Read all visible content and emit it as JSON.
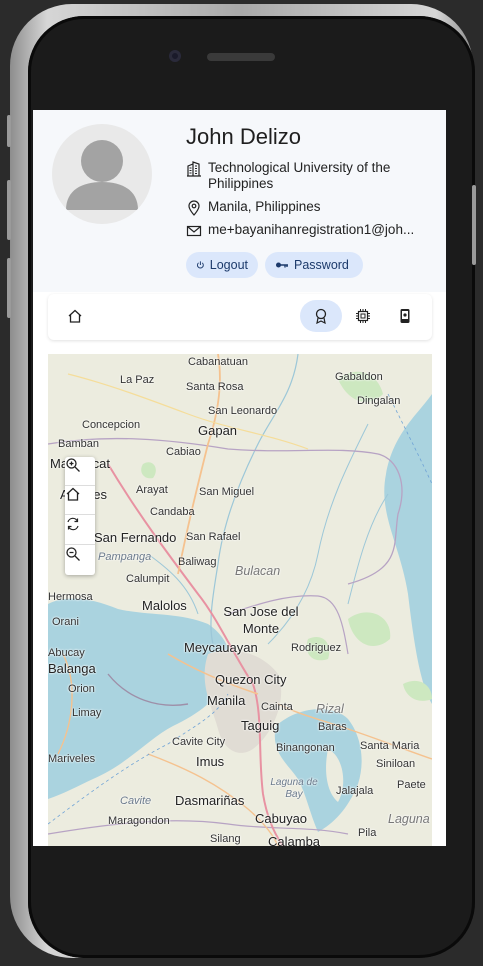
{
  "profile": {
    "name": "John Delizo",
    "university": "Technological University of the Philippines",
    "location": "Manila, Philippines",
    "email": "me+bayanihanregistration1@joh..."
  },
  "actions": {
    "logout_label": "Logout",
    "password_label": "Password"
  },
  "nav": {
    "items": [
      "home-icon",
      "badge-icon",
      "chip-icon",
      "device-icon"
    ],
    "active": "badge-icon"
  },
  "map": {
    "labels": {
      "cabanatuan": "Cabanatuan",
      "gabaldon": "Gabaldon",
      "lapaz": "La Paz",
      "santarosa": "Santa Rosa",
      "dingalan": "Dingalan",
      "sanleonardo": "San Leonardo",
      "concepcion": "Concepcion",
      "gapan": "Gapan",
      "bamban": "Bamban",
      "cabiao": "Cabiao",
      "mabalacat": "Mabalacat",
      "arayat": "Arayat",
      "sanmiguel": "San Miguel",
      "angeles": "Angeles",
      "candaba": "Candaba",
      "sanfernando": "San Fernando",
      "sanrafael": "San Rafael",
      "pampanga": "Pampanga",
      "baliwag": "Baliwag",
      "bulacan": "Bulacan",
      "calumpit": "Calumpit",
      "hermosa": "Hermosa",
      "malolos": "Malolos",
      "sanjosedelmonte": "San Jose del Monte",
      "orani": "Orani",
      "abucay": "Abucay",
      "meycauayan": "Meycauayan",
      "rodriguez": "Rodriguez",
      "balanga": "Balanga",
      "quezoncity": "Quezon City",
      "orion": "Orion",
      "manila": "Manila",
      "cainta": "Cainta",
      "rizal": "Rizal",
      "limay": "Limay",
      "taguig": "Taguig",
      "baras": "Baras",
      "mariveles": "Mariveles",
      "cavitecity": "Cavite City",
      "binangonan": "Binangonan",
      "santamaria": "Santa Maria",
      "imus": "Imus",
      "siniloan": "Siniloan",
      "lagunadebay": "Laguna de Bay",
      "jalajala": "Jalajala",
      "paete": "Paete",
      "cavite": "Cavite",
      "dasmarinas": "Dasmariñas",
      "maragondon": "Maragondon",
      "cabuyao": "Cabuyao",
      "pila": "Pila",
      "laguna": "Laguna",
      "silang": "Silang",
      "calamba": "Calamba"
    },
    "controls": [
      "zoom-in-icon",
      "home-icon",
      "refresh-icon",
      "zoom-out-icon"
    ]
  },
  "colors": {
    "accent_pill": "#dbe7fb",
    "profile_bg": "#f6f8fb",
    "water": "#aad3df",
    "land": "#ececdf"
  }
}
